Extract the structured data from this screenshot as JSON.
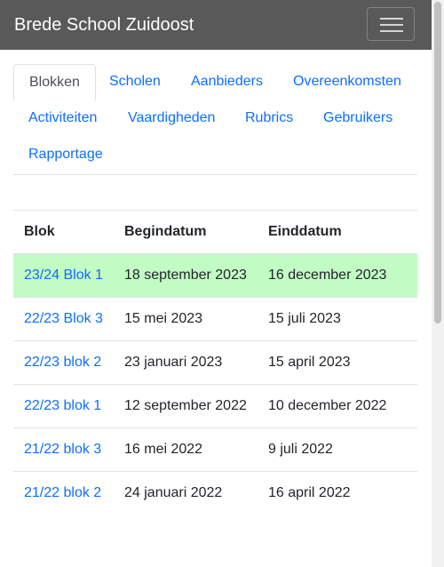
{
  "navbar": {
    "brand": "Brede School Zuidoost",
    "toggler_icon": "hamburger-icon"
  },
  "tabs": [
    {
      "label": "Blokken",
      "active": true
    },
    {
      "label": "Scholen"
    },
    {
      "label": "Aanbieders"
    },
    {
      "label": "Overeenkomsten"
    },
    {
      "label": "Activiteiten"
    },
    {
      "label": "Vaardigheden"
    },
    {
      "label": "Rubrics"
    },
    {
      "label": "Gebruikers"
    },
    {
      "label": "Rapportage"
    }
  ],
  "table": {
    "headers": [
      "Blok",
      "Begindatum",
      "Einddatum"
    ],
    "rows": [
      {
        "blok": "23/24 Blok 1",
        "begin": "18 september 2023",
        "eind": "16 december 2023"
      },
      {
        "blok": "22/23 Blok 3",
        "begin": "15 mei 2023",
        "eind": "15 juli 2023"
      },
      {
        "blok": "22/23 blok 2",
        "begin": "23 januari 2023",
        "eind": "15 april 2023"
      },
      {
        "blok": "22/23 blok 1",
        "begin": "12 september 2022",
        "eind": "10 december 2022"
      },
      {
        "blok": "21/22 blok 3",
        "begin": "16 mei 2022",
        "eind": "9 juli 2022"
      },
      {
        "blok": "21/22 blok 2",
        "begin": "24 januari 2022",
        "eind": "16 april 2022"
      }
    ]
  },
  "colors": {
    "navbar_bg": "#595959",
    "link": "#0d6efd",
    "current_row_bg": "#c3fbc5"
  }
}
